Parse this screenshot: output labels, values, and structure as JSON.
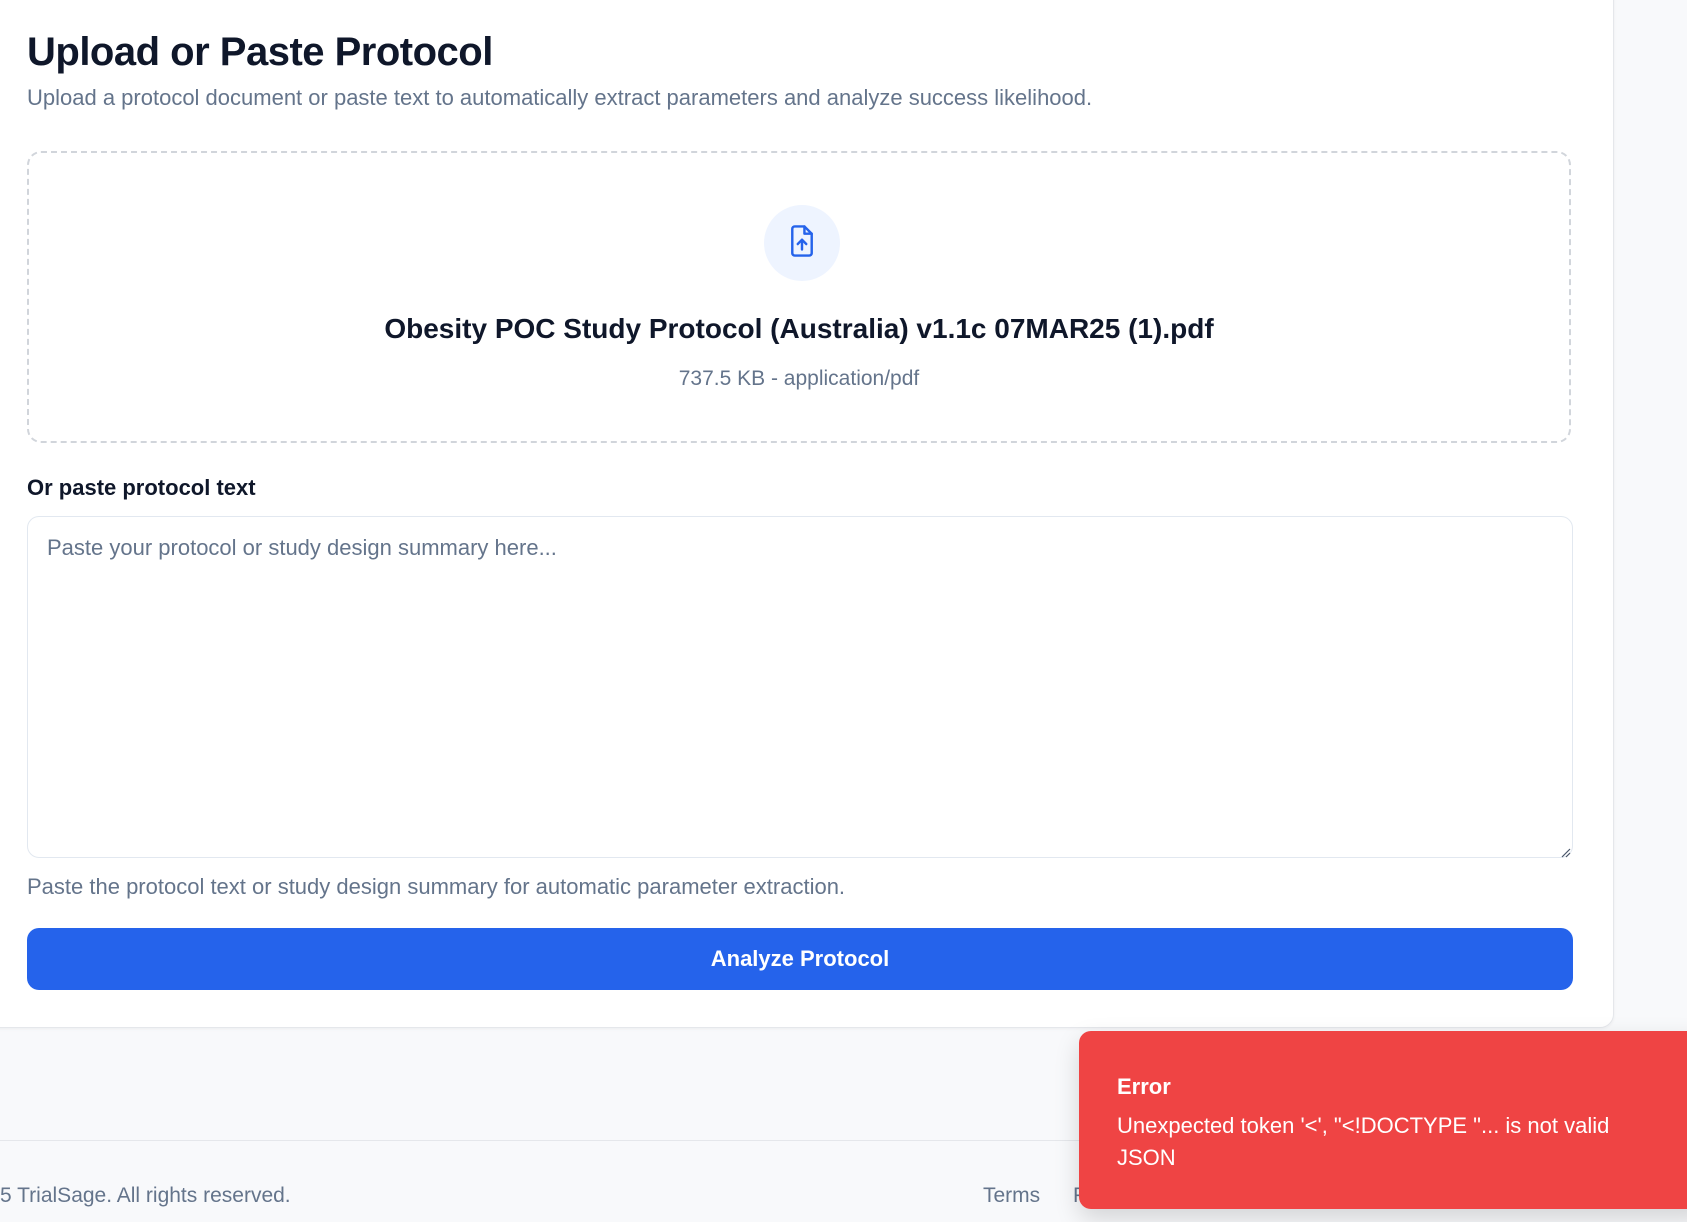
{
  "page": {
    "title": "Upload or Paste Protocol",
    "subtitle": "Upload a protocol document or paste text to automatically extract parameters and analyze success likelihood."
  },
  "upload": {
    "icon": "file-upload-icon",
    "file_name": "Obesity POC Study Protocol (Australia) v1.1c 07MAR25 (1).pdf",
    "file_meta": "737.5 KB - application/pdf"
  },
  "paste": {
    "label": "Or paste protocol text",
    "value": "",
    "placeholder": "Paste your protocol or study design summary here...",
    "helper": "Paste the protocol text or study design summary for automatic parameter extraction."
  },
  "actions": {
    "analyze_label": "Analyze Protocol"
  },
  "footer": {
    "copyright": "5 TrialSage. All rights reserved.",
    "links": [
      "Terms",
      "P"
    ]
  },
  "toast": {
    "title": "Error",
    "message": "Unexpected token '<', \"<!DOCTYPE \"... is not valid JSON"
  },
  "colors": {
    "accent": "#2563eb",
    "error": "#ef4444",
    "icon_bg": "#eef4ff",
    "muted_text": "#64748b"
  }
}
